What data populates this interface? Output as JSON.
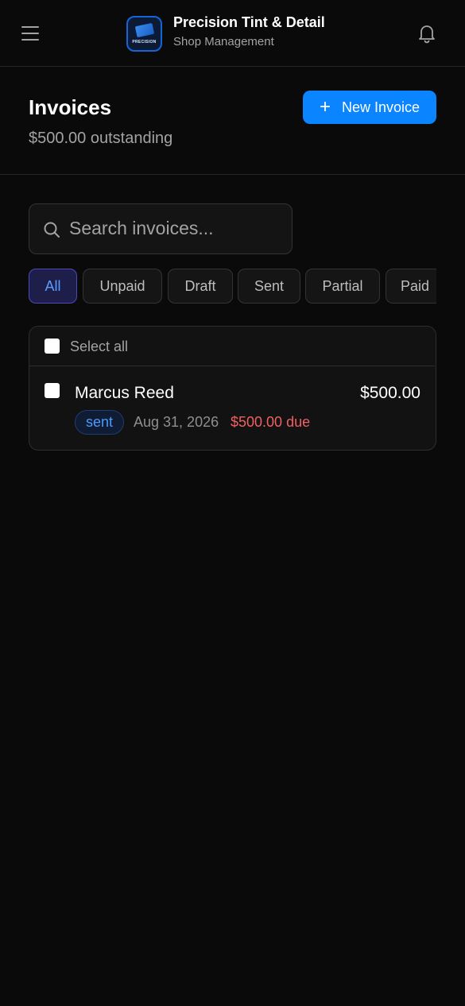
{
  "header": {
    "brand_title": "Precision Tint & Detail",
    "brand_subtitle": "Shop Management",
    "logo_text": "PRECISION",
    "icons": {
      "menu": "hamburger-menu-icon",
      "notifications": "bell-icon"
    }
  },
  "page": {
    "title": "Invoices",
    "outstanding": "$500.00 outstanding",
    "new_button_label": "New Invoice",
    "new_button_icon": "+"
  },
  "search": {
    "placeholder": "Search invoices...",
    "value": ""
  },
  "filters": [
    {
      "label": "All",
      "active": true
    },
    {
      "label": "Unpaid",
      "active": false
    },
    {
      "label": "Draft",
      "active": false
    },
    {
      "label": "Sent",
      "active": false
    },
    {
      "label": "Partial",
      "active": false
    },
    {
      "label": "Paid",
      "active": false
    }
  ],
  "list": {
    "select_all_label": "Select all",
    "invoices": [
      {
        "customer": "Marcus Reed",
        "amount": "$500.00",
        "status": "sent",
        "date": "Aug 31, 2026",
        "due": "$500.00 due"
      }
    ]
  },
  "colors": {
    "background": "#0a0a0a",
    "accent": "#0a84ff",
    "status_sent": "#4b9aff",
    "due": "#f06060",
    "active_chip_bg": "#1e1e4a"
  }
}
